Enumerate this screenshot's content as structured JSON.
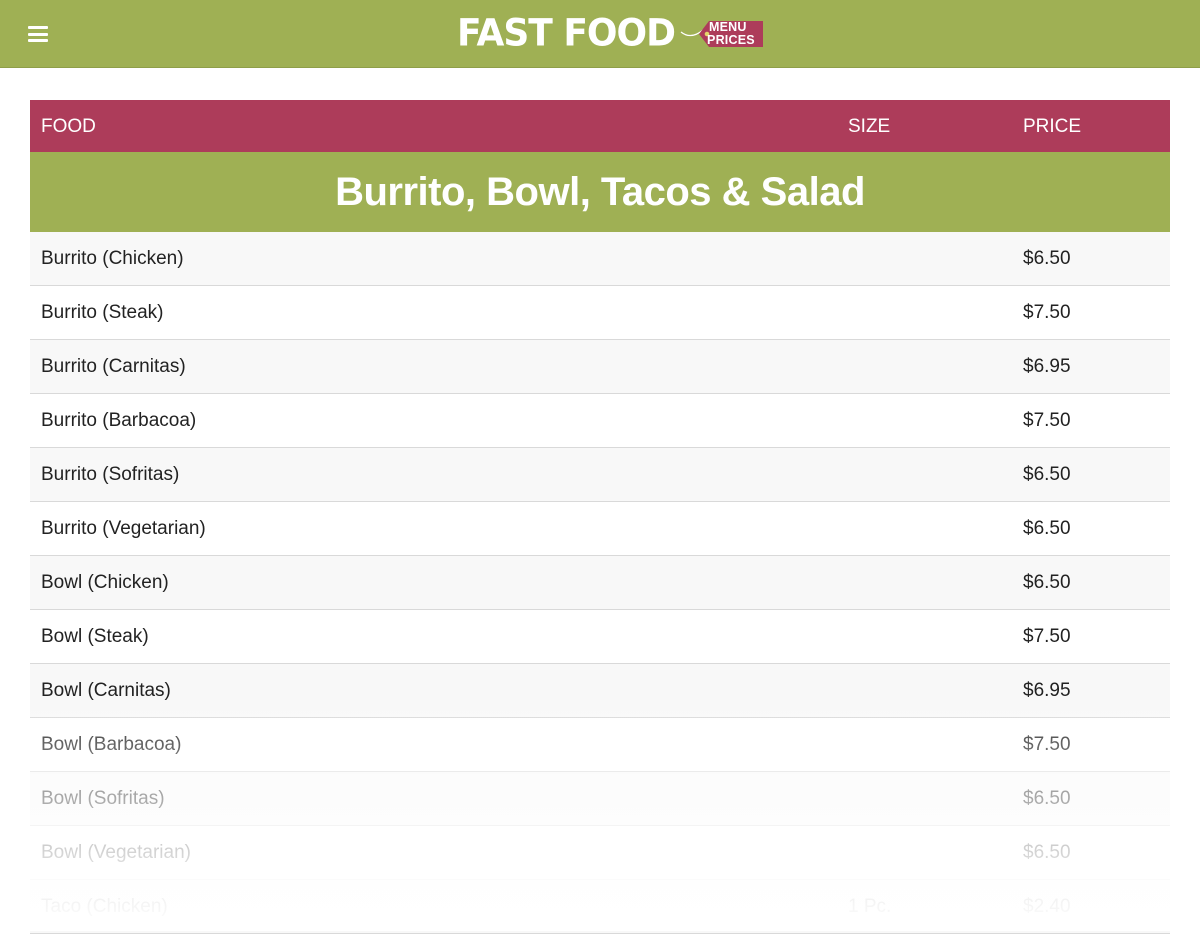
{
  "header": {
    "logo_main": "FAST FOOD",
    "logo_tag_line1": "MENU",
    "logo_tag_line2": "PRICES",
    "menu_icon": "hamburger-icon"
  },
  "colors": {
    "header_bg": "#9fb054",
    "table_head_bg": "#ad3c5a",
    "section_bg": "#9fb054"
  },
  "table": {
    "columns": {
      "food": "FOOD",
      "size": "SIZE",
      "price": "PRICE"
    },
    "section_title": "Burrito, Bowl, Tacos & Salad",
    "rows": [
      {
        "food": "Burrito (Chicken)",
        "size": "",
        "price": "$6.50"
      },
      {
        "food": "Burrito (Steak)",
        "size": "",
        "price": "$7.50"
      },
      {
        "food": "Burrito (Carnitas)",
        "size": "",
        "price": "$6.95"
      },
      {
        "food": "Burrito (Barbacoa)",
        "size": "",
        "price": "$7.50"
      },
      {
        "food": "Burrito (Sofritas)",
        "size": "",
        "price": "$6.50"
      },
      {
        "food": "Burrito (Vegetarian)",
        "size": "",
        "price": "$6.50"
      },
      {
        "food": "Bowl (Chicken)",
        "size": "",
        "price": "$6.50"
      },
      {
        "food": "Bowl (Steak)",
        "size": "",
        "price": "$7.50"
      },
      {
        "food": "Bowl (Carnitas)",
        "size": "",
        "price": "$6.95"
      },
      {
        "food": "Bowl (Barbacoa)",
        "size": "",
        "price": "$7.50"
      },
      {
        "food": "Bowl (Sofritas)",
        "size": "",
        "price": "$6.50"
      },
      {
        "food": "Bowl (Vegetarian)",
        "size": "",
        "price": "$6.50"
      },
      {
        "food": "Taco (Chicken)",
        "size": "1 Pc.",
        "price": "$2.40"
      }
    ]
  }
}
